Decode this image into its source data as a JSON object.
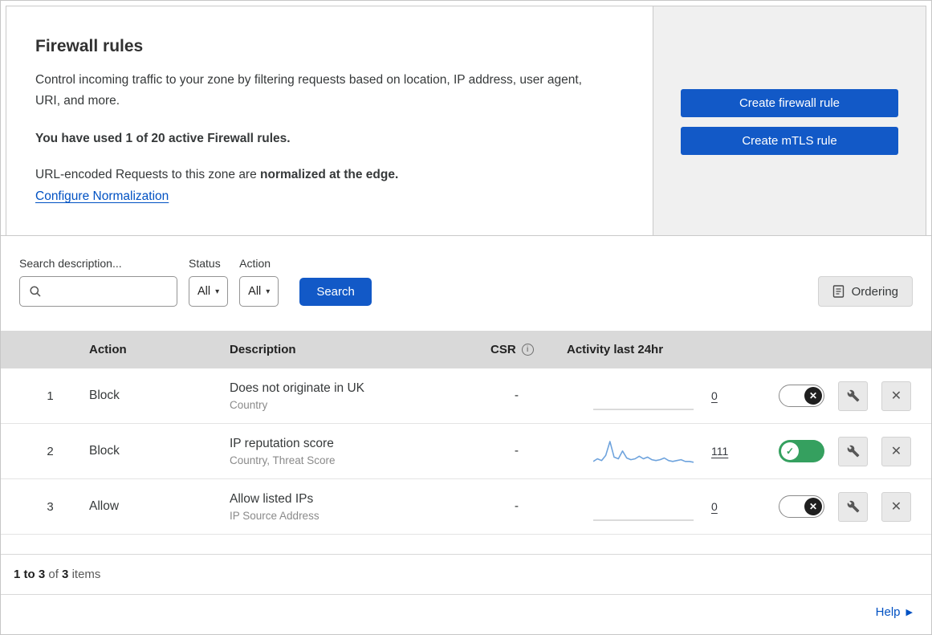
{
  "header": {
    "title": "Firewall rules",
    "description": "Control incoming traffic to your zone by filtering requests based on location, IP address, user agent, URI, and more.",
    "usage": "You have used 1 of 20 active Firewall rules.",
    "normalization_text": "URL-encoded Requests to this zone are",
    "normalization_bold": "normalized at the edge.",
    "normalization_link": "Configure Normalization"
  },
  "actions_panel": {
    "create_firewall_rule": "Create firewall rule",
    "create_mtls_rule": "Create mTLS rule"
  },
  "filters": {
    "search_label": "Search description...",
    "status_label": "Status",
    "status_value": "All",
    "action_label": "Action",
    "action_value": "All",
    "search_button": "Search",
    "ordering_button": "Ordering"
  },
  "table": {
    "headers": {
      "action": "Action",
      "description": "Description",
      "csr": "CSR",
      "activity": "Activity last 24hr"
    },
    "rows": [
      {
        "index": "1",
        "action": "Block",
        "description": "Does not originate in UK",
        "filter_fields": "Country",
        "csr": "-",
        "activity_count": "0",
        "enabled": false,
        "sparkline": []
      },
      {
        "index": "2",
        "action": "Block",
        "description": "IP reputation score",
        "filter_fields": "Country, Threat Score",
        "csr": "-",
        "activity_count": "111",
        "enabled": true,
        "sparkline": [
          3,
          6,
          4,
          10,
          26,
          8,
          6,
          15,
          7,
          5,
          6,
          9,
          6,
          8,
          5,
          4,
          5,
          7,
          4,
          3,
          4,
          5,
          3,
          3,
          2
        ]
      },
      {
        "index": "3",
        "action": "Allow",
        "description": "Allow listed IPs",
        "filter_fields": "IP Source Address",
        "csr": "-",
        "activity_count": "0",
        "enabled": false,
        "sparkline": []
      }
    ]
  },
  "footer": {
    "range": "1 to 3",
    "of": "of",
    "total": "3",
    "items": "items"
  },
  "help": {
    "label": "Help"
  },
  "icons": {
    "check": "✓",
    "cross": "✕",
    "caret_down": "▾",
    "arrow_right": "▶",
    "info": "i"
  },
  "colors": {
    "primary_blue": "#1259c7",
    "link_blue": "#0051c3",
    "toggle_on_green": "#35a05f",
    "spark_line": "#6ea3dd",
    "table_header_bg": "#d9d9d9",
    "panel_bg": "#f0f0f0"
  }
}
